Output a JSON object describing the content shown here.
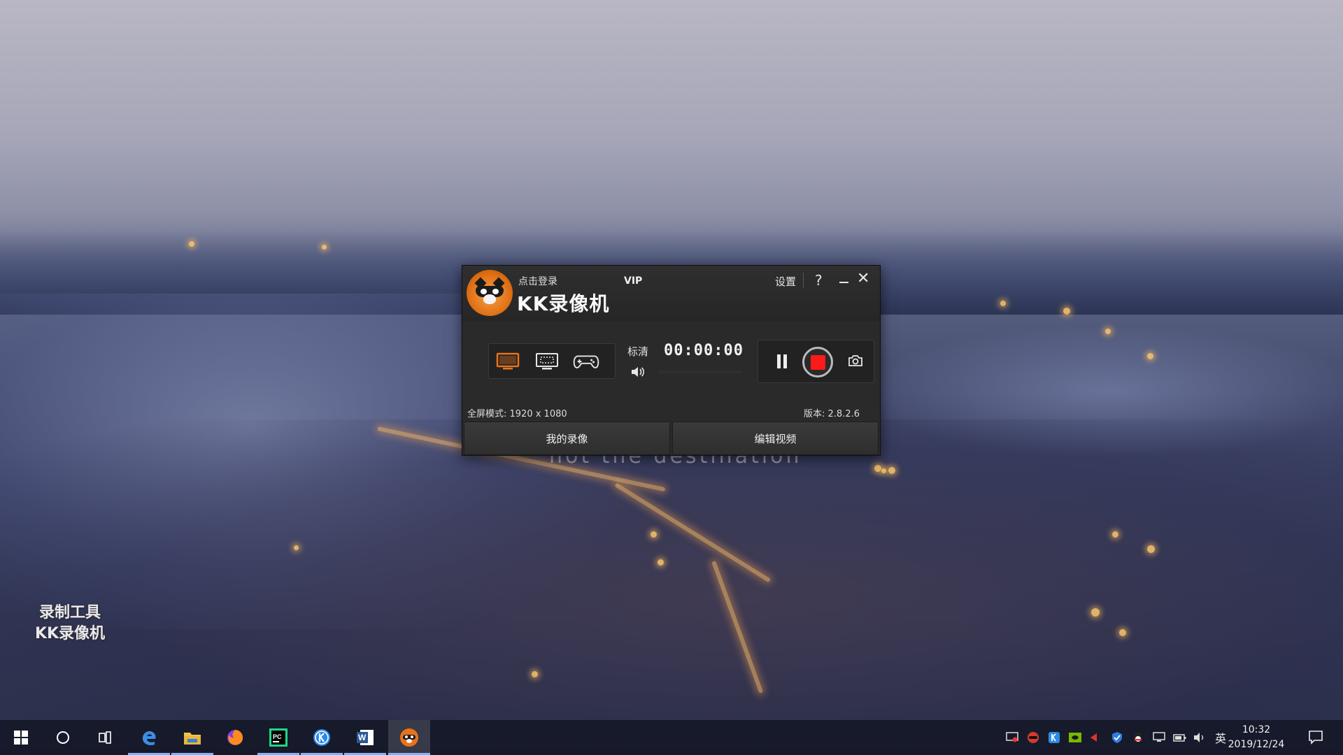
{
  "desktop": {
    "watermark_line1": "录制工具",
    "watermark_line2": "KK录像机",
    "subtitle_fragment": "not the destination"
  },
  "recorder": {
    "login_label": "点击登录",
    "vip_label": "VIP",
    "brand_name": "KK录像机",
    "settings_label": "设置",
    "help_label": "?",
    "close_label": "✕",
    "quality_label": "标清",
    "timer": "00:00:00",
    "fullscreen_mode": "全屏模式: 1920 x 1080",
    "version": "版本: 2.8.2.6",
    "tabs": [
      {
        "label": "我的录像"
      },
      {
        "label": "编辑视频"
      }
    ],
    "modes": [
      {
        "icon": "fullscreen-mode-icon",
        "active": true
      },
      {
        "icon": "region-mode-icon",
        "active": false
      },
      {
        "icon": "game-mode-icon",
        "active": false
      }
    ],
    "colors": {
      "accent_orange": "#e8731a",
      "record_red": "#ff1a1a"
    }
  },
  "taskbar": {
    "apps": [
      {
        "icon": "windows-start-icon"
      },
      {
        "icon": "cortana-search-icon"
      },
      {
        "icon": "task-view-icon"
      },
      {
        "icon": "edge-icon"
      },
      {
        "icon": "file-explorer-icon"
      },
      {
        "icon": "firefox-icon"
      },
      {
        "icon": "pycharm-icon"
      },
      {
        "icon": "k-app-icon"
      },
      {
        "icon": "word-icon"
      },
      {
        "icon": "kk-recorder-icon"
      }
    ],
    "ime": "英",
    "time": "10:32",
    "date": "2019/12/24"
  }
}
